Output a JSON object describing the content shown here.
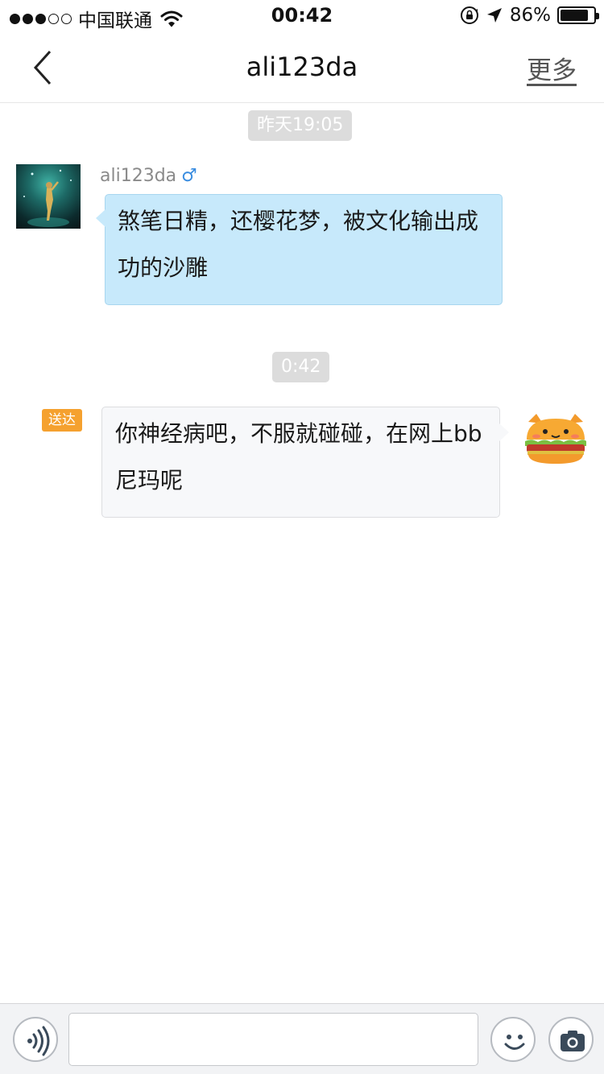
{
  "status_bar": {
    "signal_dots_filled": 3,
    "signal_dots_total": 5,
    "carrier": "中国联通",
    "time": "00:42",
    "battery_percent_label": "86%",
    "battery_level": 0.86
  },
  "nav": {
    "title": "ali123da",
    "more_label": "更多"
  },
  "chat": {
    "messages": [
      {
        "timestamp": "昨天19:05",
        "sender_name": "ali123da",
        "gender_symbol": "♂",
        "text": "煞笔日精，还樱花梦，被文化输出成功的沙雕",
        "direction": "incoming"
      },
      {
        "timestamp": "0:42",
        "status_badge": "送达",
        "text": "你神经病吧，不服就碰碰，在网上bb尼玛呢",
        "direction": "outgoing"
      }
    ]
  },
  "input_bar": {
    "message_value": "",
    "icons": [
      "voice-icon",
      "emoji-icon",
      "camera-icon"
    ]
  },
  "colors": {
    "incoming_bubble": "#c7e9fb",
    "outgoing_bubble": "#f7f8fa",
    "badge": "#f5a12f",
    "gender": "#3a8de0",
    "timestamp_bg": "#dcdcdc"
  }
}
